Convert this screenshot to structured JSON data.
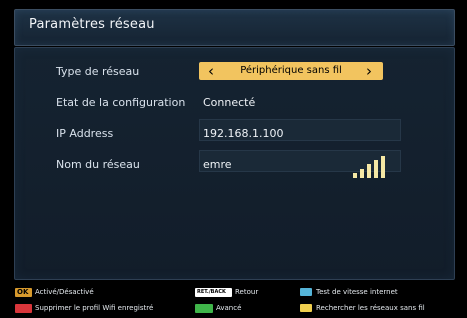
{
  "window": {
    "title": "Paramètres réseau"
  },
  "settings": {
    "network_type": {
      "label": "Type de réseau",
      "value": "Périphérique sans fil"
    },
    "config_state": {
      "label": "Etat de la configuration",
      "value": "Connecté"
    },
    "ip_address": {
      "label": "IP Address",
      "value": "192.168.1.100"
    },
    "network_name": {
      "label": "Nom du réseau",
      "value": "emre",
      "signal_bars": 5
    }
  },
  "legend": [
    {
      "key": "OK",
      "text": "Activé/Désactivé",
      "color": "#d89a2d"
    },
    {
      "key": "RET./BACK",
      "text": "Retour",
      "color": "#ffffff"
    },
    {
      "key": "",
      "text": "Test de vitesse internet",
      "color": "#55b4d8"
    },
    {
      "key": "",
      "text": "Supprimer le profil Wifi enregistré",
      "color": "#d9363b"
    },
    {
      "key": "",
      "text": "Avancé",
      "color": "#40b54a"
    },
    {
      "key": "",
      "text": "Rechercher les réseaux sans fil",
      "color": "#f0cf4e"
    }
  ],
  "colors": {
    "selector": "#f2c45f",
    "signal": "#f5e8a5"
  }
}
